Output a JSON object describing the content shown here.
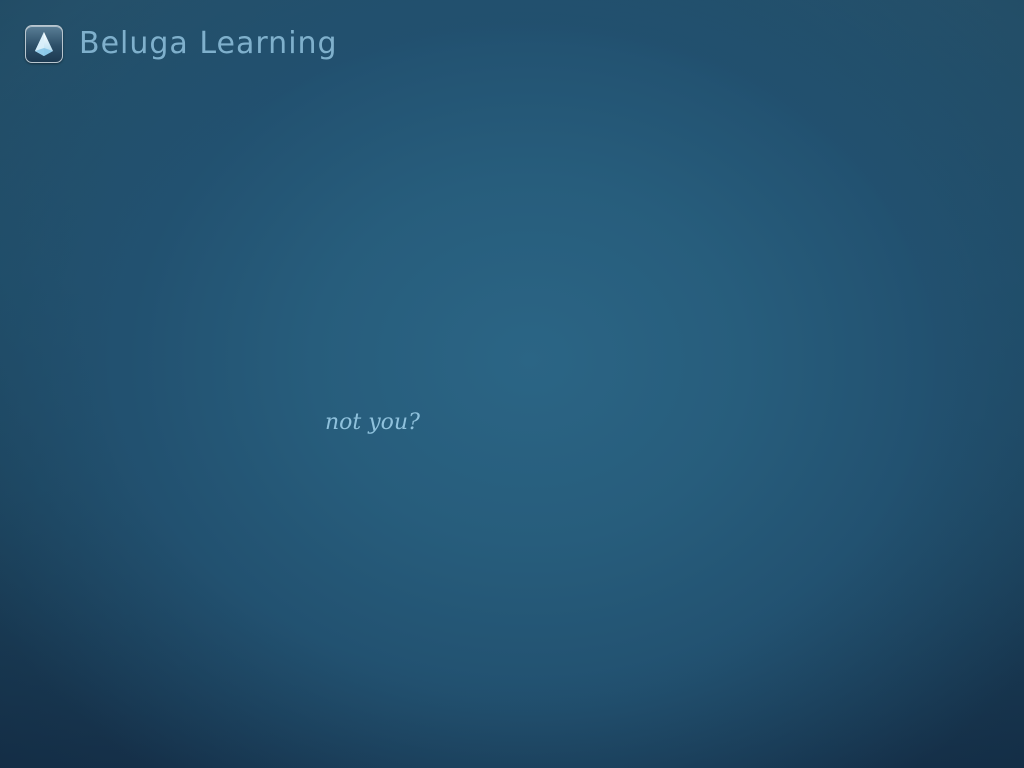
{
  "brand": {
    "icon": "beluga-logo-icon",
    "title": "Beluga Learning"
  },
  "account": {
    "not_you_link": "not you?"
  },
  "colors": {
    "background_center": "#2b6585",
    "background_edge": "#183550",
    "title_text": "#7fb0cc",
    "link_text": "#8fc1dc"
  }
}
